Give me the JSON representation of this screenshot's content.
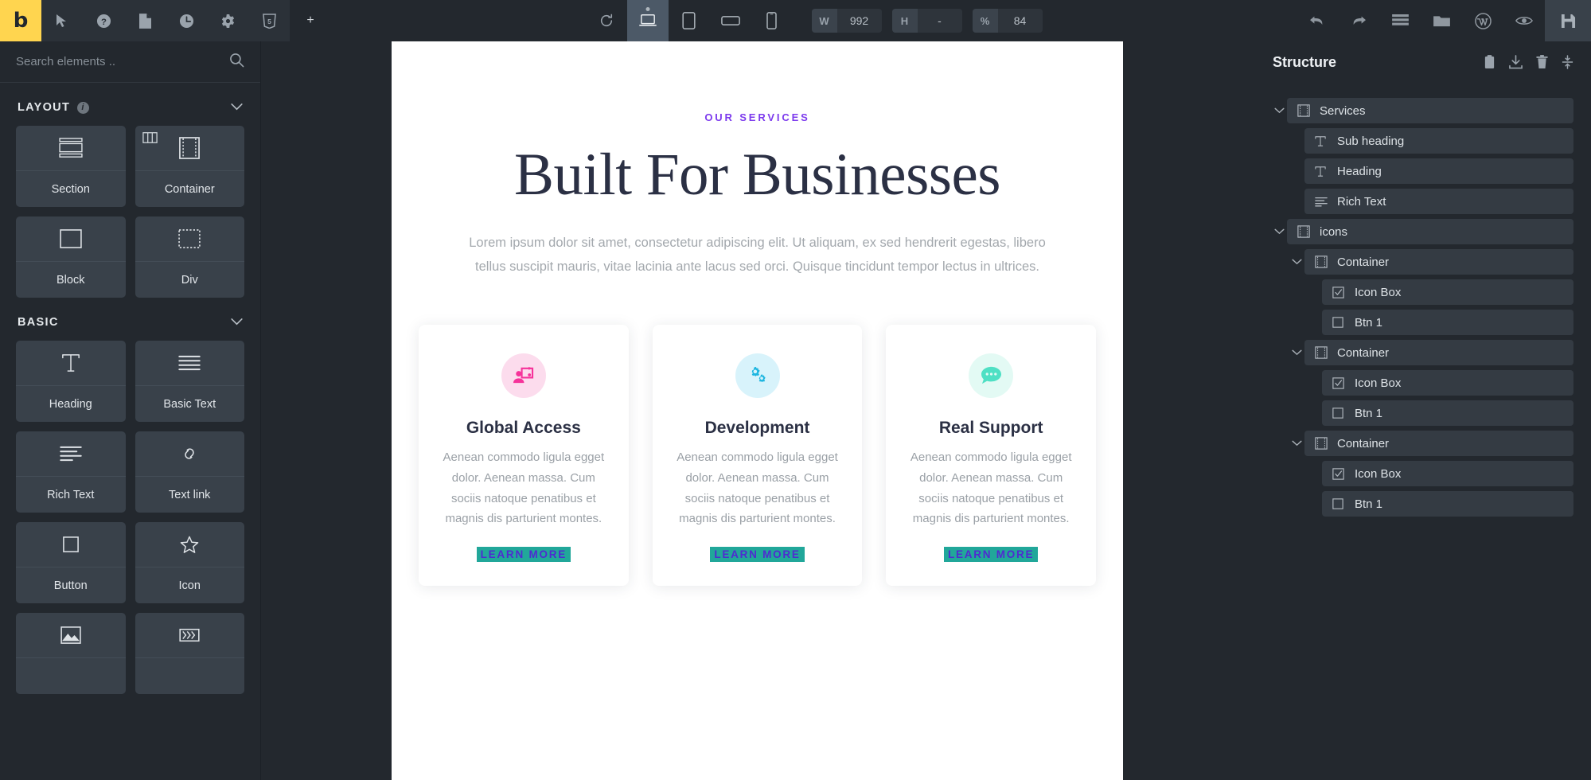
{
  "toolbar": {
    "logo_label": "b",
    "left_icons": [
      {
        "name": "cursor-icon",
        "title": "Select"
      },
      {
        "name": "help-icon",
        "title": "Help"
      },
      {
        "name": "page-icon",
        "title": "Page"
      },
      {
        "name": "history-icon",
        "title": "Revisions"
      },
      {
        "name": "settings-icon",
        "title": "Settings"
      },
      {
        "name": "css-icon",
        "title": "CSS"
      }
    ],
    "add_label": "+",
    "refresh_label": "refresh-icon",
    "devices": [
      {
        "name": "desktop-icon",
        "label": "Desktop",
        "active": true
      },
      {
        "name": "tablet-portrait-icon",
        "label": "Tablet portrait",
        "active": false
      },
      {
        "name": "tablet-landscape-icon",
        "label": "Tablet landscape",
        "active": false
      },
      {
        "name": "mobile-icon",
        "label": "Mobile portrait",
        "active": false
      }
    ],
    "fields": [
      {
        "label": "W",
        "value": "992"
      },
      {
        "label": "H",
        "value": "-"
      },
      {
        "label": "%",
        "value": "84"
      }
    ],
    "right_icons": [
      {
        "name": "undo-icon",
        "title": "Undo"
      },
      {
        "name": "redo-icon",
        "title": "Redo"
      },
      {
        "name": "structure-icon",
        "title": "Structure"
      },
      {
        "name": "folder-icon",
        "title": "Templates"
      },
      {
        "name": "wordpress-icon",
        "title": "WordPress"
      },
      {
        "name": "preview-icon",
        "title": "Preview"
      }
    ],
    "save_label": "save-icon"
  },
  "elements_panel": {
    "search": {
      "placeholder": "Search elements ..",
      "value": ""
    },
    "groups": [
      {
        "title": "LAYOUT",
        "has_info": true,
        "tiles": [
          {
            "label": "Section",
            "icon": "section-icon",
            "corner": null
          },
          {
            "label": "Container",
            "icon": "container-icon",
            "corner": "columns-icon"
          },
          {
            "label": "Block",
            "icon": "block-icon",
            "corner": null
          },
          {
            "label": "Div",
            "icon": "div-icon",
            "corner": null
          }
        ]
      },
      {
        "title": "BASIC",
        "has_info": false,
        "tiles": [
          {
            "label": "Heading",
            "icon": "heading-icon",
            "corner": null
          },
          {
            "label": "Basic Text",
            "icon": "basic-text-icon",
            "corner": null
          },
          {
            "label": "Rich Text",
            "icon": "rich-text-icon",
            "corner": null
          },
          {
            "label": "Text link",
            "icon": "link-icon",
            "corner": null
          },
          {
            "label": "Button",
            "icon": "button-icon",
            "corner": null
          },
          {
            "label": "Icon",
            "icon": "star-icon",
            "corner": null
          },
          {
            "label": "",
            "icon": "image-icon",
            "corner": null
          },
          {
            "label": "",
            "icon": "video-icon",
            "corner": null
          }
        ]
      }
    ]
  },
  "canvas": {
    "eyebrow": "OUR SERVICES",
    "heading": "Built For Businesses",
    "lead": "Lorem ipsum dolor sit amet, consectetur adipiscing elit. Ut aliquam, ex sed hendrerit egestas, libero tellus suscipit mauris, vitae lacinia ante lacus sed orci. Quisque tincidunt tempor lectus in ultrices.",
    "cards": [
      {
        "title": "Global Access",
        "text": "Aenean commodo ligula egget dolor. Aenean massa. Cum sociis natoque penatibus et magnis dis parturient montes.",
        "cta": "LEARN MORE",
        "icon": "presentation-user-icon",
        "icon_color": "#f6339a",
        "icon_bg": "#fcdced"
      },
      {
        "title": "Development",
        "text": "Aenean commodo ligula egget dolor. Aenean massa. Cum sociis natoque penatibus et magnis dis parturient montes.",
        "cta": "LEARN MORE",
        "icon": "gears-icon",
        "icon_color": "#1fb6e0",
        "icon_bg": "#d8f3fb"
      },
      {
        "title": "Real Support",
        "text": "Aenean commodo ligula egget dolor. Aenean massa. Cum sociis natoque penatibus et magnis dis parturient montes.",
        "cta": "LEARN MORE",
        "icon": "chat-bubble-icon",
        "icon_color": "#4fe0c4",
        "icon_bg": "#e3faf4"
      }
    ],
    "accent_purple": "#7c3aed",
    "cta_highlight": "#21a79a",
    "cta_text_color": "#4f2bd0"
  },
  "structure": {
    "title": "Structure",
    "actions": [
      {
        "name": "clipboard-icon",
        "title": "Copy"
      },
      {
        "name": "download-icon",
        "title": "Import"
      },
      {
        "name": "trash-icon",
        "title": "Delete"
      },
      {
        "name": "collapse-icon",
        "title": "Collapse all"
      }
    ],
    "nodes": [
      {
        "label": "Services",
        "icon": "container-icon",
        "depth": 1,
        "caret": "down"
      },
      {
        "label": "Sub heading",
        "icon": "text-icon",
        "depth": 2,
        "caret": ""
      },
      {
        "label": "Heading",
        "icon": "text-icon",
        "depth": 2,
        "caret": ""
      },
      {
        "label": "Rich Text",
        "icon": "rich-text-icon",
        "depth": 2,
        "caret": ""
      },
      {
        "label": "icons",
        "icon": "container-icon",
        "depth": 1,
        "caret": "down"
      },
      {
        "label": "Container",
        "icon": "container-icon",
        "depth": 2,
        "caret": "down"
      },
      {
        "label": "Icon Box",
        "icon": "icon-box-icon",
        "depth": 3,
        "caret": ""
      },
      {
        "label": "Btn 1",
        "icon": "button-icon",
        "depth": 3,
        "caret": ""
      },
      {
        "label": "Container",
        "icon": "container-icon",
        "depth": 2,
        "caret": "down"
      },
      {
        "label": "Icon Box",
        "icon": "icon-box-icon",
        "depth": 3,
        "caret": ""
      },
      {
        "label": "Btn 1",
        "icon": "button-icon",
        "depth": 3,
        "caret": ""
      },
      {
        "label": "Container",
        "icon": "container-icon",
        "depth": 2,
        "caret": "down"
      },
      {
        "label": "Icon Box",
        "icon": "icon-box-icon",
        "depth": 3,
        "caret": ""
      },
      {
        "label": "Btn 1",
        "icon": "button-icon",
        "depth": 3,
        "caret": ""
      }
    ]
  }
}
